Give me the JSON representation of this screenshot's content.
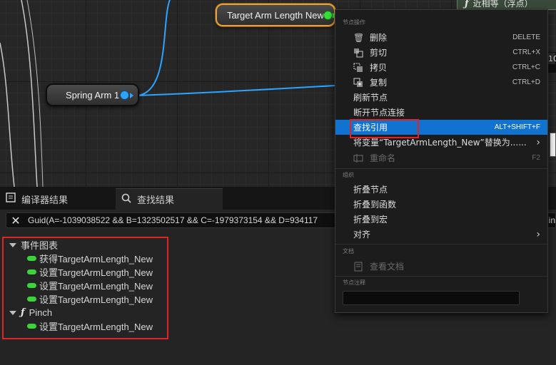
{
  "graph": {
    "nodes": {
      "target_arm": "Target Arm Length New",
      "spring_arm": "Spring Arm 1"
    },
    "func_node_label": "近相等（浮点）",
    "side_box_text": "10"
  },
  "tabs": {
    "compiler": "编译器结果",
    "find": "查找结果"
  },
  "search": {
    "query": "Guid(A=-1039038522 && B=1323502517 && C=-1979373154 && D=934117",
    "trailing": "in"
  },
  "results": {
    "groups": [
      {
        "label": "事件图表",
        "items": [
          "获得TargetArmLength_New",
          "设置TargetArmLength_New",
          "设置TargetArmLength_New",
          "设置TargetArmLength_New"
        ]
      },
      {
        "label": "Pinch",
        "items": [
          "设置TargetArmLength_New"
        ]
      }
    ]
  },
  "menu": {
    "section_node_actions": "节点操作",
    "delete": {
      "label": "删除",
      "shortcut": "DELETE"
    },
    "cut": {
      "label": "剪切",
      "shortcut": "CTRL+X"
    },
    "copy": {
      "label": "拷贝",
      "shortcut": "CTRL+C"
    },
    "duplicate": {
      "label": "复制",
      "shortcut": "CTRL+D"
    },
    "refresh": "刷新节点",
    "break_links": "断开节点连接",
    "find_refs": {
      "label": "查找引用",
      "shortcut": "ALT+SHIFT+F"
    },
    "replace_var": "将变量“TargetArmLength_New”替换为......",
    "rename": {
      "label": "重命名",
      "shortcut": "F2"
    },
    "section_org": "组织",
    "collapse_nodes": "折叠节点",
    "collapse_func": "折叠到函数",
    "collapse_macro": "折叠到宏",
    "align": "对齐",
    "section_docs": "文档",
    "view_docs": "查看文档",
    "section_comment": "节点注释"
  },
  "colors": {
    "accent": "#1272d0",
    "highlight_border": "#e02424",
    "float_pin": "#38e03a",
    "object_pin": "#2ea3ff",
    "selected_node": "#e8a13a"
  }
}
